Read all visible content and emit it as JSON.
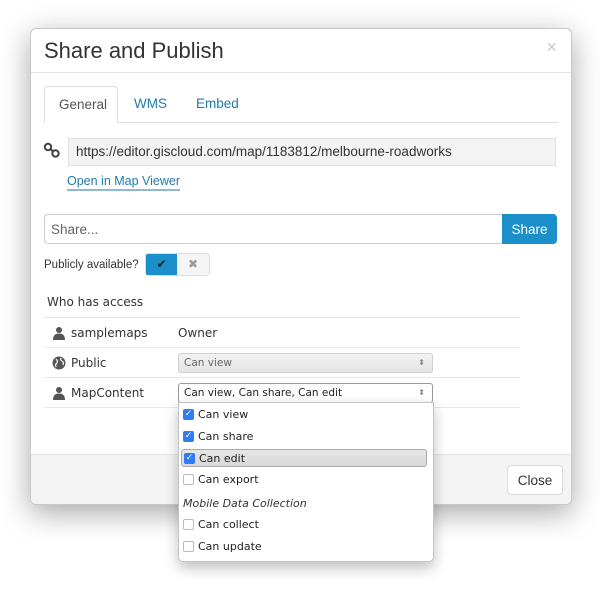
{
  "dialog": {
    "title": "Share and Publish",
    "close_glyph": "×"
  },
  "tabs": [
    {
      "label": "General",
      "active": true
    },
    {
      "label": "WMS",
      "active": false
    },
    {
      "label": "Embed",
      "active": false
    }
  ],
  "url": {
    "value": "https://editor.giscloud.com/map/1183812/melbourne-roadworks",
    "open_link": "Open in Map Viewer"
  },
  "share": {
    "placeholder": "Share...",
    "button_label": "Share",
    "accent": "#1a8fc9"
  },
  "public": {
    "label": "Publicly available?",
    "on_glyph": "✔",
    "off_glyph": "✖",
    "enabled": true
  },
  "access": {
    "title": "Who has access",
    "rows": [
      {
        "icon": "user-icon",
        "name": "samplemaps",
        "role": "Owner"
      },
      {
        "icon": "globe-icon",
        "name": "Public",
        "permission": "Can view",
        "disabled": true
      },
      {
        "icon": "user-icon",
        "name": "MapContent",
        "permission": "Can view, Can share, Can edit",
        "disabled": false
      }
    ],
    "select_arrows": "⬍"
  },
  "dropdown": {
    "options": [
      {
        "label": "Can view",
        "checked": true
      },
      {
        "label": "Can share",
        "checked": true
      },
      {
        "label": "Can edit",
        "checked": true,
        "highlighted": true
      },
      {
        "label": "Can export",
        "checked": false
      }
    ],
    "group_label": "Mobile Data Collection",
    "group_options": [
      {
        "label": "Can collect",
        "checked": false
      },
      {
        "label": "Can update",
        "checked": false
      }
    ],
    "check_glyph": "✓"
  },
  "footer": {
    "close_label": "Close"
  }
}
